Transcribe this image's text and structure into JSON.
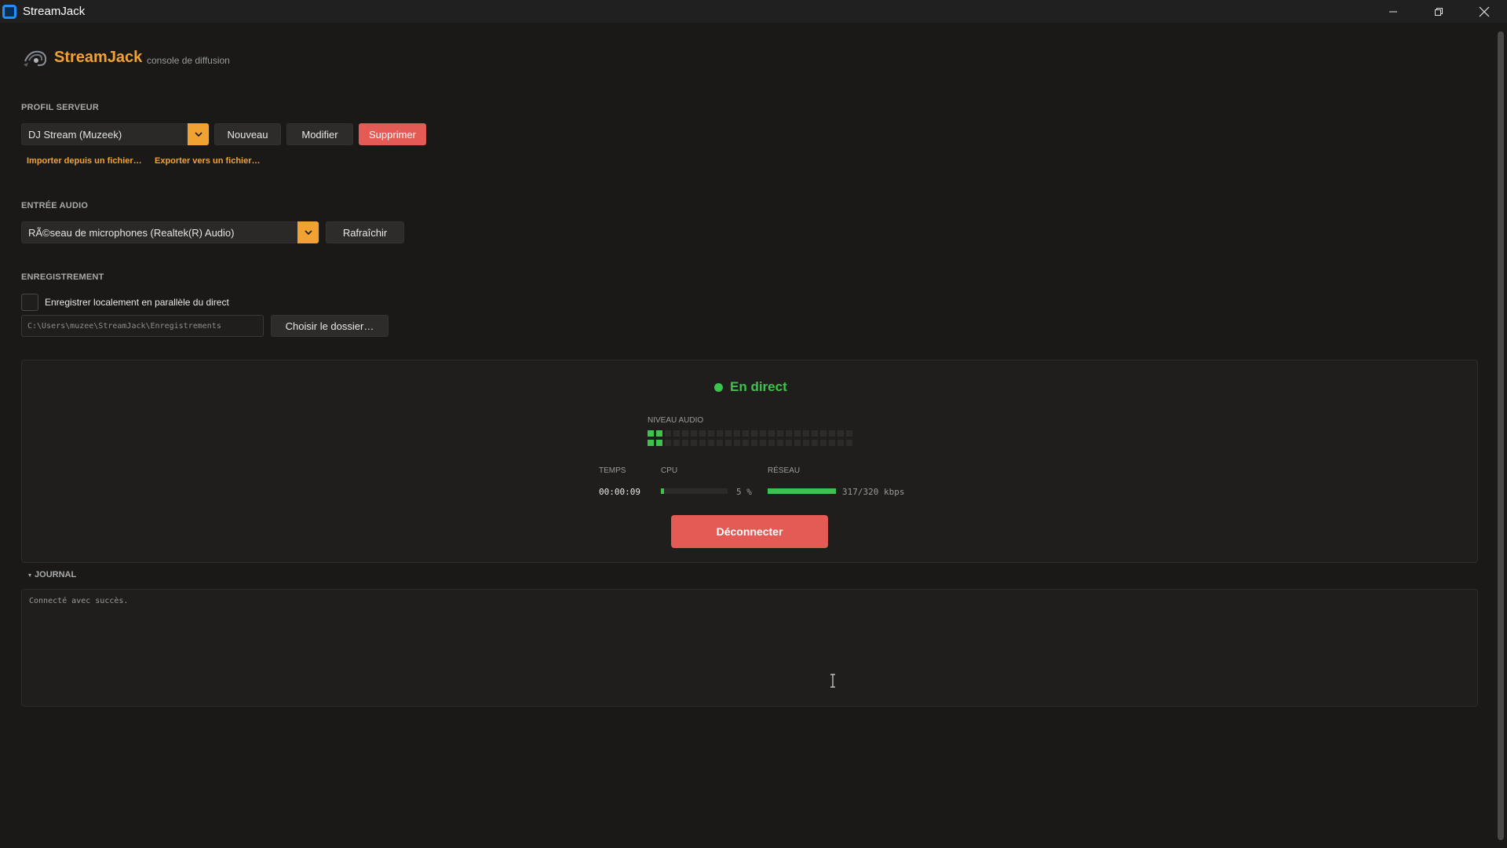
{
  "window": {
    "title": "StreamJack"
  },
  "header": {
    "brand": "StreamJack",
    "subtitle": "console de diffusion"
  },
  "server_profile": {
    "label": "PROFIL SERVEUR",
    "selected": "DJ Stream (Muzeek)",
    "new_label": "Nouveau",
    "edit_label": "Modifier",
    "delete_label": "Supprimer",
    "import_label": "Importer depuis un fichier…",
    "export_label": "Exporter vers un fichier…"
  },
  "audio_input": {
    "label": "ENTRÉE AUDIO",
    "selected": "RÃ©seau de microphones (Realtek(R) Audio)",
    "refresh_label": "Rafraîchir"
  },
  "recording": {
    "label": "ENREGISTREMENT",
    "checkbox_label": "Enregistrer localement en parallèle du direct",
    "checked": false,
    "path": "C:\\Users\\muzee\\StreamJack\\Enregistrements",
    "choose_label": "Choisir le dossier…"
  },
  "live": {
    "status": "En direct",
    "status_color": "#3ec24f",
    "meter_label": "NIVEAU AUDIO",
    "meter_segments": 24,
    "meter_active": 2,
    "time_label": "TEMPS",
    "time_value": "00:00:09",
    "cpu_label": "CPU",
    "cpu_value": "5 %",
    "cpu_fraction": 0.05,
    "network_label": "RÉSEAU",
    "network_value": "317/320 kbps",
    "network_fraction": 0.99,
    "disconnect_label": "Déconnecter"
  },
  "journal": {
    "label": "JOURNAL",
    "lines": [
      "Connecté avec succès."
    ]
  },
  "colors": {
    "accent": "#f0a332",
    "danger": "#e45b55",
    "ok": "#3ec24f"
  }
}
